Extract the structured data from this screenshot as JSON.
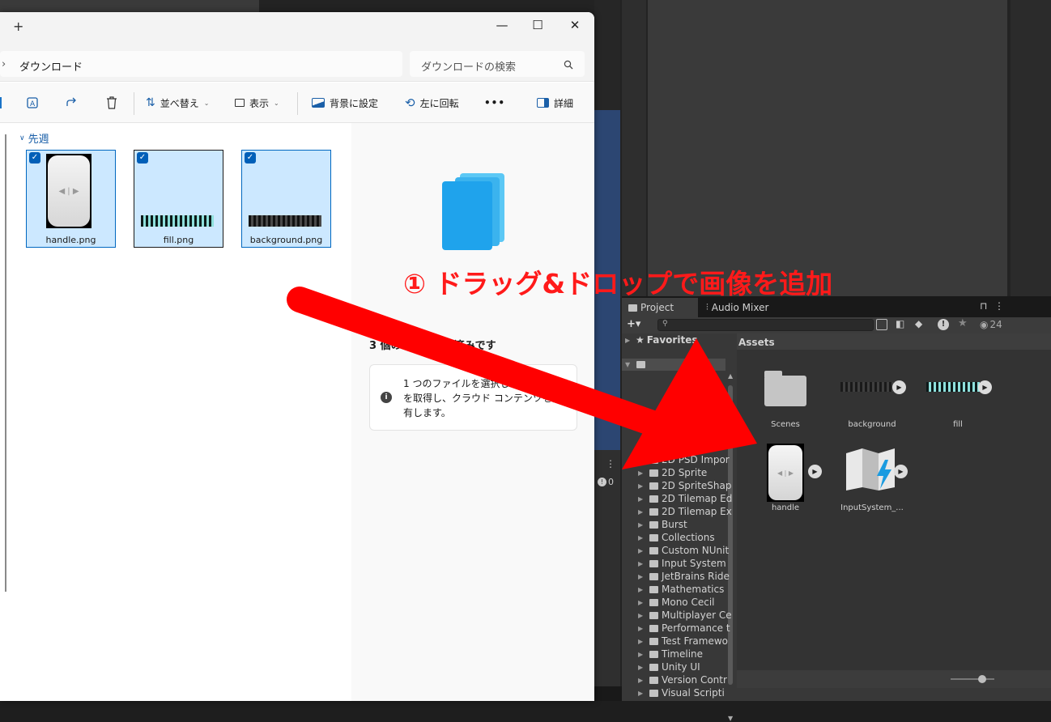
{
  "explorer": {
    "new_tab_symbol": "+",
    "window_buttons": {
      "minimize": "—",
      "maximize": "☐",
      "close": "✕"
    },
    "breadcrumb_chevron": "›",
    "address": "ダウンロード",
    "search_placeholder": "ダウンロードの検索",
    "toolbar": {
      "sort": "並べ替え",
      "view": "表示",
      "set_background": "背景に設定",
      "rotate_left": "左に回転",
      "more": "•••",
      "details": "詳細"
    },
    "group_label": "先週",
    "files": [
      {
        "name": "handle.png"
      },
      {
        "name": "fill.png"
      },
      {
        "name": "background.png"
      }
    ],
    "details_pane": {
      "selected_text": "3 個の項目が選択済みです",
      "info_text": "1 つのファイルを選択して、詳細情報を取得し、クラウド コンテンツを共有します。"
    }
  },
  "unity": {
    "tabs": {
      "project": "Project",
      "audio_mixer": "Audio Mixer"
    },
    "toolbar": {
      "add": "+▾",
      "count": "24"
    },
    "console_count": "0",
    "favorites": "Favorites",
    "assets_header": "Assets",
    "tree_items": [
      "2D PSD Impor",
      "2D Sprite",
      "2D SpriteShap",
      "2D Tilemap Ed",
      "2D Tilemap Ex",
      "Burst",
      "Collections",
      "Custom NUnit",
      "Input System",
      "JetBrains Ride",
      "Mathematics",
      "Mono Cecil",
      "Multiplayer Ce",
      "Performance t",
      "Test Framewo",
      "Timeline",
      "Unity UI",
      "Version Contr",
      "Visual Scripti"
    ],
    "assets": [
      {
        "name": "Scenes"
      },
      {
        "name": "background"
      },
      {
        "name": "fill"
      },
      {
        "name": "handle"
      },
      {
        "name": "InputSystem_..."
      }
    ]
  },
  "annotation": "① ドラッグ&ドロップで画像を追加",
  "colors": {
    "arrow": "#ff0000",
    "selection": "#cce8ff",
    "accent": "#005fb8",
    "unity_panel": "#383838"
  }
}
